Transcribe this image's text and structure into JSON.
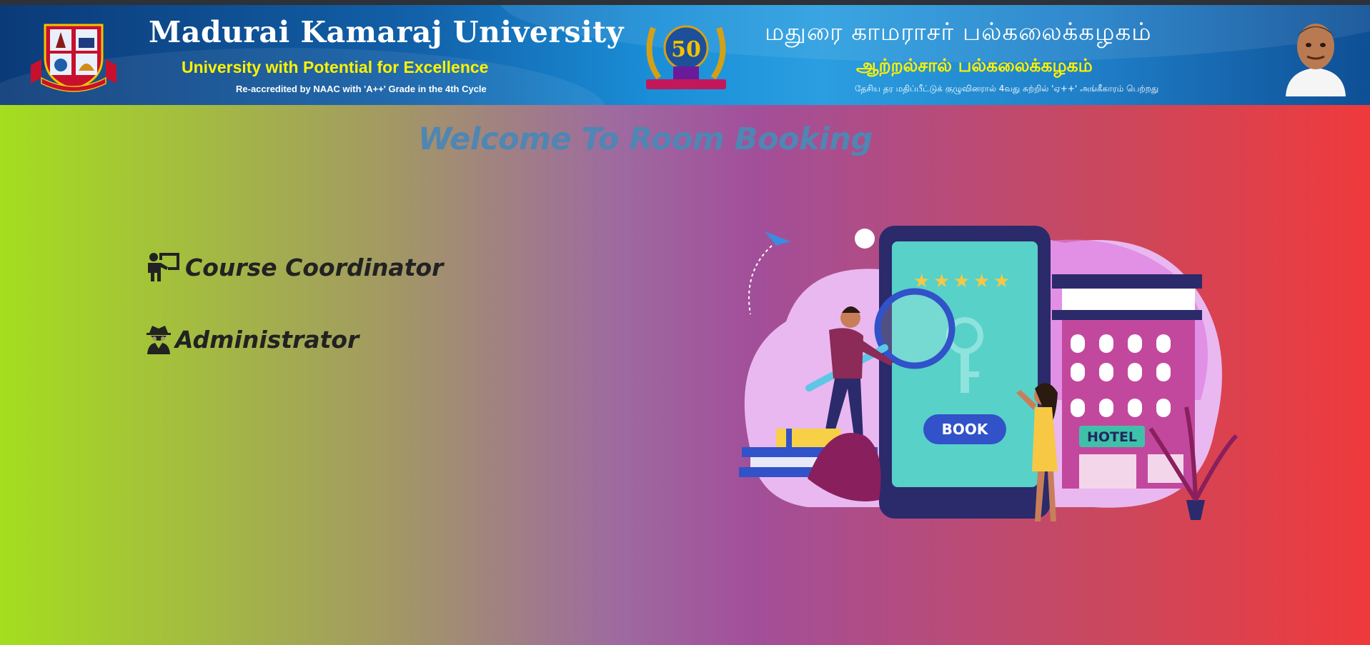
{
  "header": {
    "university_name": "Madurai Kamaraj University",
    "tagline": "University with Potential for Excellence",
    "accreditation": "Re-accredited by NAAC with 'A++' Grade in the 4th Cycle",
    "tamil_name": "மதுரை காமராசர் பல்கலைக்கழகம்",
    "tamil_tagline": "ஆற்றல்சால் பல்கலைக்கழகம்",
    "tamil_accreditation": "தேசிய தர மதிப்பீட்டுக் குழுவினரால் 4வது சுற்றில் 'ஏ++' அங்கீகாரம் பெற்றது",
    "emblem_number": "50"
  },
  "main": {
    "welcome": "Welcome To Room Booking",
    "menu": [
      {
        "label": "Course Coordinator",
        "icon": "chalkboard-teacher-icon"
      },
      {
        "label": "Administrator",
        "icon": "user-secret-icon"
      }
    ]
  },
  "illustration": {
    "book_label": "BOOK",
    "hotel_label": "HOTEL",
    "stars": 5
  },
  "colors": {
    "gradient_left": "#a4de1e",
    "gradient_right": "#ef3a3c",
    "welcome_text": "#4f86b3",
    "banner_blue": "#1a8fd8",
    "tagline_yellow": "#fff200"
  }
}
